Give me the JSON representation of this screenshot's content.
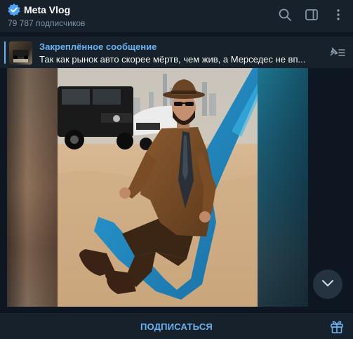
{
  "channel": {
    "title": "Meta Vlog",
    "subscribers": "79 787 подписчиков"
  },
  "pinned": {
    "title": "Закреплённое сообщение",
    "text": "Так как рынок авто скорее мёртв, чем жив, а Мерседес не вп..."
  },
  "bottom": {
    "subscribe_label": "ПОДПИСАТЬСЯ"
  },
  "icons": {
    "verified": "verified-badge-icon",
    "search": "search-icon",
    "sidebar": "sidebar-toggle-icon",
    "more": "more-vertical-icon",
    "unpin": "pin-list-icon",
    "scroll": "chevron-down-icon",
    "gift": "gift-icon"
  },
  "colors": {
    "accent": "#6ab3f3",
    "header_bg": "#17212b",
    "chat_bg": "#0e1621"
  }
}
